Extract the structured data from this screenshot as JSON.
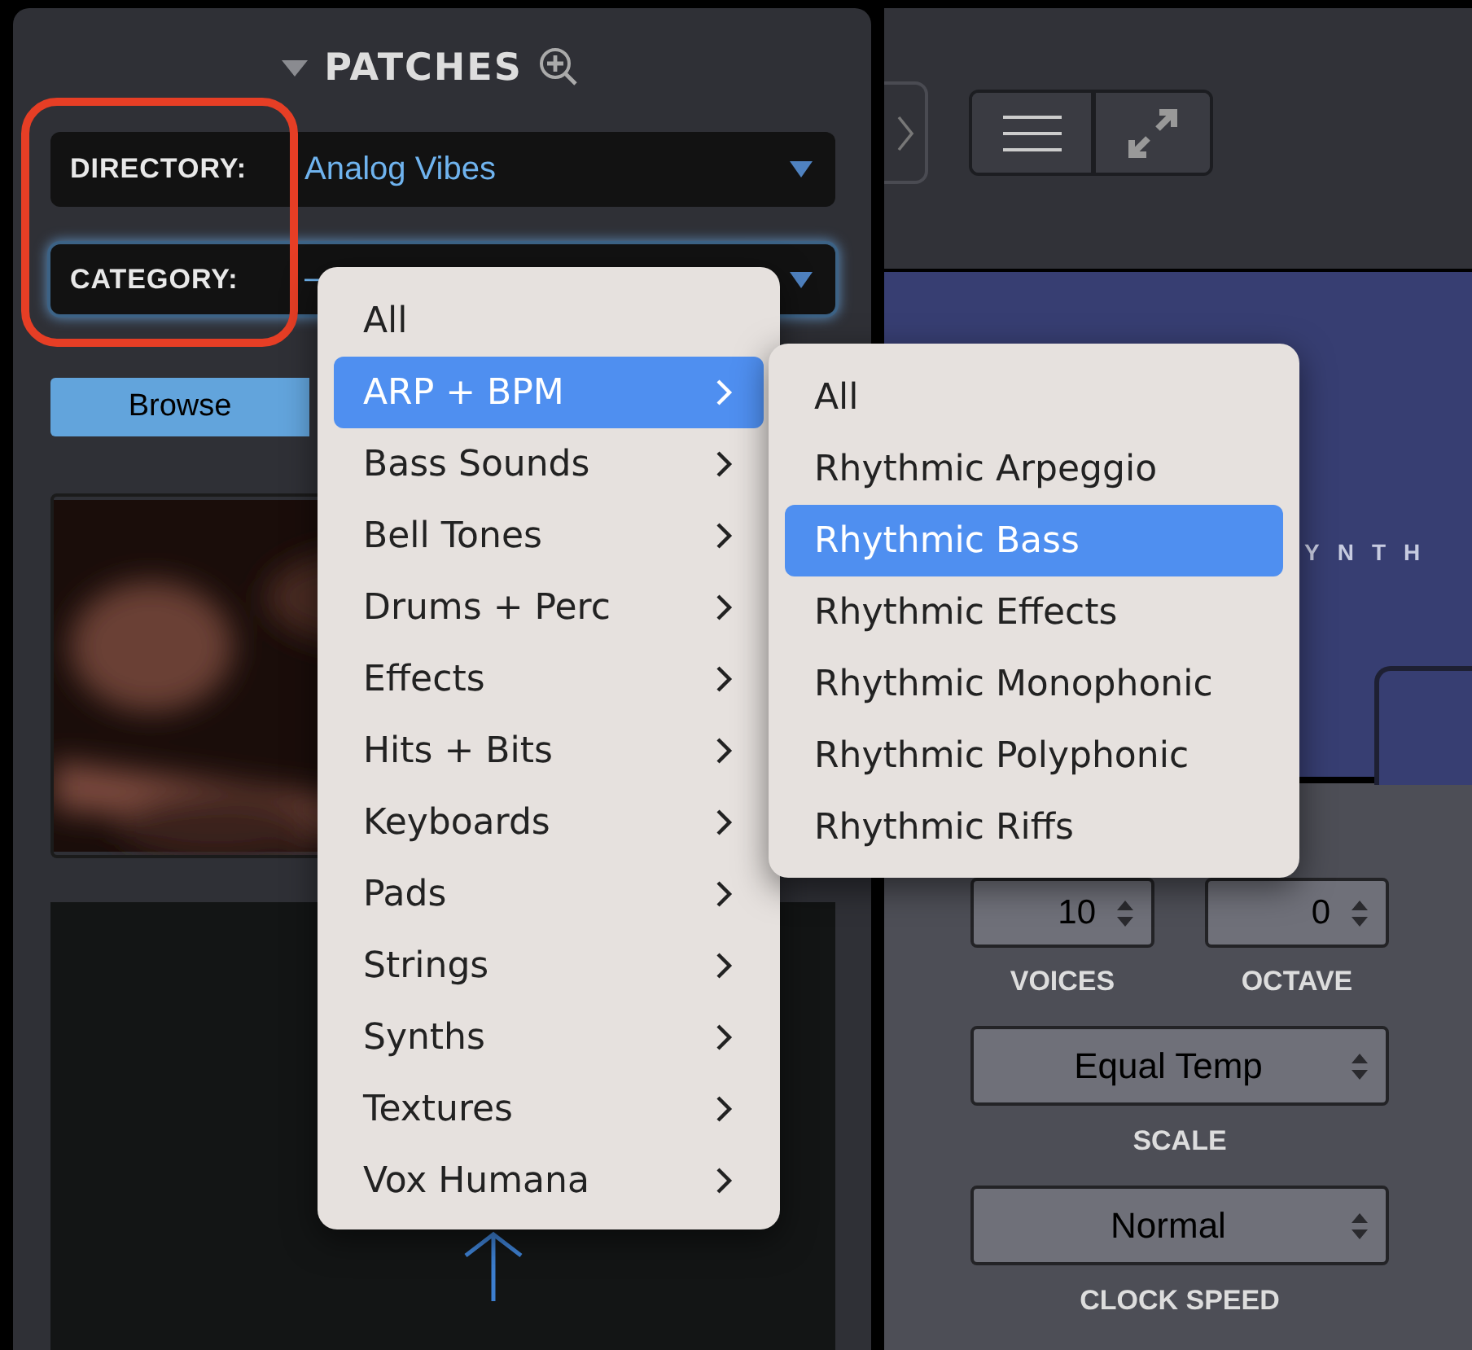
{
  "patches": {
    "title": "PATCHES",
    "expanded": true,
    "directory": {
      "label": "DIRECTORY:",
      "value": "Analog Vibes"
    },
    "category": {
      "label": "CATEGORY:",
      "value": "–",
      "focused": true
    },
    "tabs": [
      {
        "label": "Browse",
        "selected": true
      }
    ]
  },
  "category_menu": {
    "items": [
      {
        "label": "All",
        "selected": false,
        "has_submenu": false
      },
      {
        "label": "ARP + BPM",
        "selected": true,
        "has_submenu": true
      },
      {
        "label": "Bass Sounds",
        "selected": false,
        "has_submenu": true
      },
      {
        "label": "Bell Tones",
        "selected": false,
        "has_submenu": true
      },
      {
        "label": "Drums + Perc",
        "selected": false,
        "has_submenu": true
      },
      {
        "label": "Effects",
        "selected": false,
        "has_submenu": true
      },
      {
        "label": "Hits + Bits",
        "selected": false,
        "has_submenu": true
      },
      {
        "label": "Keyboards",
        "selected": false,
        "has_submenu": true
      },
      {
        "label": "Pads",
        "selected": false,
        "has_submenu": true
      },
      {
        "label": "Strings",
        "selected": false,
        "has_submenu": true
      },
      {
        "label": "Synths",
        "selected": false,
        "has_submenu": true
      },
      {
        "label": "Textures",
        "selected": false,
        "has_submenu": true
      },
      {
        "label": "Vox Humana",
        "selected": false,
        "has_submenu": true
      }
    ]
  },
  "submenu": {
    "items": [
      {
        "label": "All",
        "selected": false
      },
      {
        "label": "Rhythmic Arpeggio",
        "selected": false
      },
      {
        "label": "Rhythmic Bass",
        "selected": true
      },
      {
        "label": "Rhythmic Effects",
        "selected": false
      },
      {
        "label": "Rhythmic Monophonic",
        "selected": false
      },
      {
        "label": "Rhythmic Polyphonic",
        "selected": false
      },
      {
        "label": "Rhythmic Riffs",
        "selected": false
      }
    ]
  },
  "banner": {
    "text": "YNTH"
  },
  "controls": {
    "spinners": [
      {
        "value": "10",
        "label": "VOICES"
      },
      {
        "value": "0",
        "label": "OCTAVE"
      }
    ],
    "selects": [
      {
        "value": "Equal Temp",
        "label": "SCALE"
      },
      {
        "value": "Normal",
        "label": "CLOCK SPEED"
      }
    ]
  }
}
